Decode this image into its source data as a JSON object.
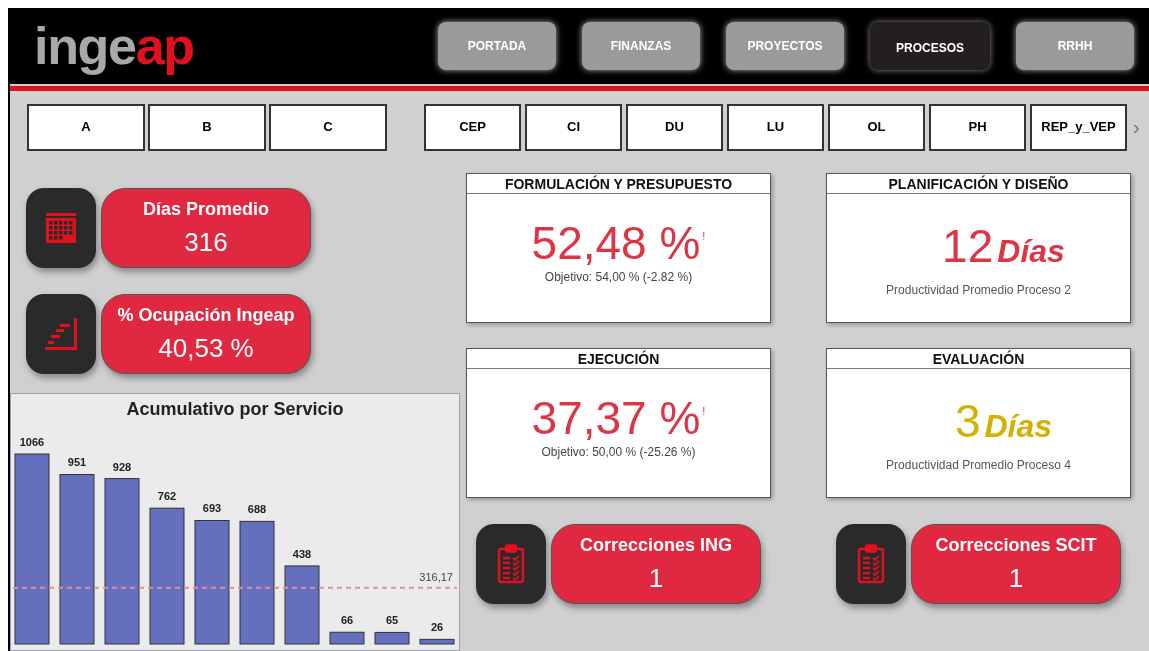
{
  "logo": {
    "part_1": "inge",
    "part_2": "ap"
  },
  "nav": [
    {
      "label": "PORTADA",
      "selected": false
    },
    {
      "label": "FINANZAS",
      "selected": false
    },
    {
      "label": "PROYECTOS",
      "selected": false
    },
    {
      "label": "PROCESOS",
      "selected": true
    },
    {
      "label": "RRHH",
      "selected": false
    }
  ],
  "filter_groups": [
    [
      "A",
      "B",
      "C"
    ],
    [
      "CEP",
      "CI",
      "DU",
      "LU",
      "OL",
      "PH",
      "REP_y_VEP"
    ]
  ],
  "filter_more": "›",
  "kpis": [
    {
      "kind": "calendar",
      "title": "Días Promedio",
      "value": "316"
    },
    {
      "kind": "stairs",
      "title": "% Ocupación Ingeap",
      "value": "40,53 %"
    }
  ],
  "chart": {
    "chart_data": {
      "type": "bar",
      "title": "Acumulativo por Servicio",
      "series": [
        {
          "color": "#6470be",
          "values": [
            1066,
            951,
            928,
            762,
            693,
            688,
            438,
            66,
            65,
            26
          ]
        }
      ],
      "data_labels": true,
      "ref_lines": [
        {
          "axis": "y",
          "value": 316.17,
          "label": "316,17",
          "color": "#e88a92"
        }
      ]
    }
  },
  "cards": [
    {
      "kind": "percent",
      "title": "FORMULACIÓN Y PRESUPUESTO",
      "value": "52,48 %",
      "flag": "!",
      "subtitle": "Objetivo: 54,00 % (-2.82 %)"
    },
    {
      "kind": "days",
      "title": "PLANIFICACIÓN Y DISEÑO",
      "value": "12",
      "unit": "Días",
      "color": "#dc3545",
      "subtitle": "Productividad Promedio Proceso 2"
    },
    {
      "kind": "percent",
      "title": "EJECUCIÓN",
      "value": "37,37 %",
      "flag": "!",
      "subtitle": "Objetivo: 50,00 % (-25.26 %)"
    },
    {
      "kind": "days",
      "title": "EVALUACIÓN",
      "value": "3",
      "unit": "Días",
      "color": "#d4b000",
      "subtitle": "Productividad Promedio Proceso 4"
    }
  ],
  "corrections": [
    {
      "title": "Correcciones ING",
      "value": "1"
    },
    {
      "title": "Correcciones SCIT",
      "value": "1"
    }
  ]
}
